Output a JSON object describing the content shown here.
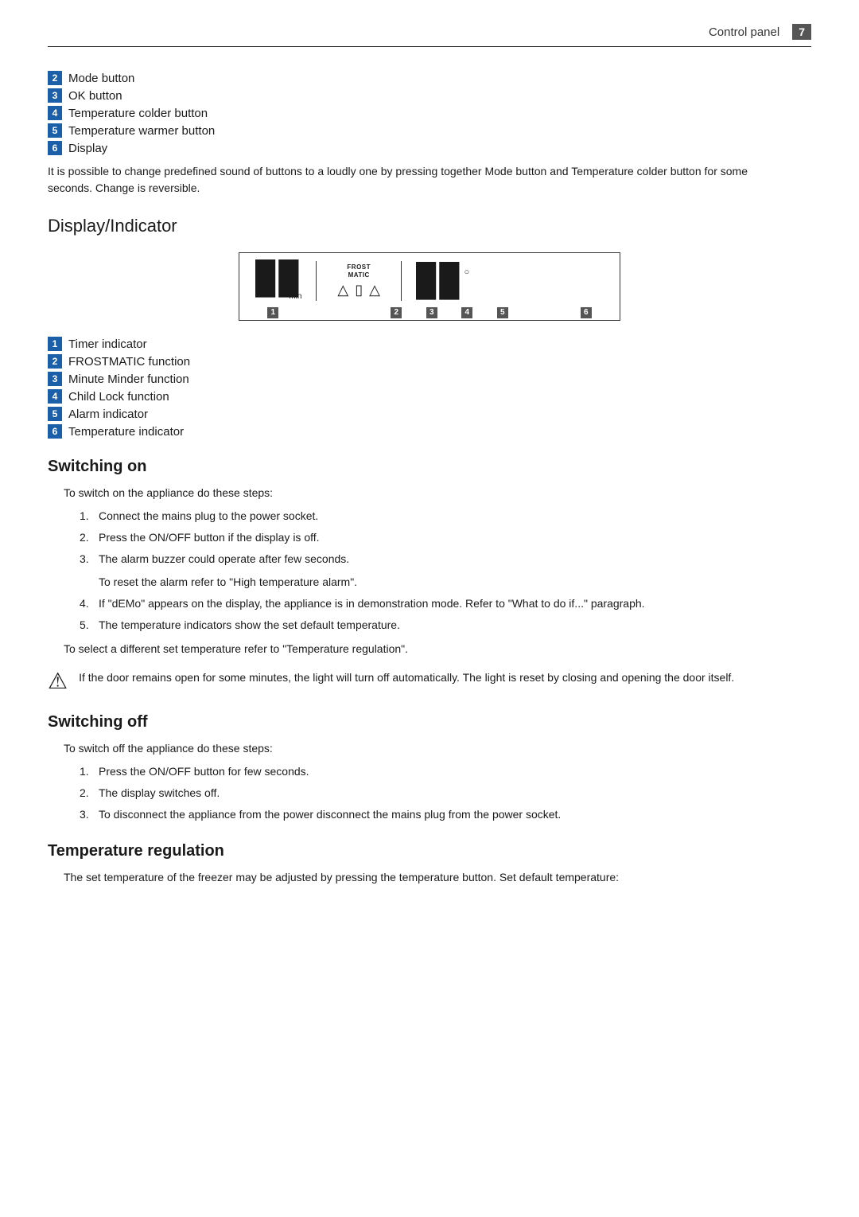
{
  "header": {
    "title": "Control panel",
    "page": "7"
  },
  "intro_list": {
    "items": [
      {
        "badge": "2",
        "label": "Mode button"
      },
      {
        "badge": "3",
        "label": "OK button"
      },
      {
        "badge": "4",
        "label": "Temperature colder button"
      },
      {
        "badge": "5",
        "label": "Temperature warmer button"
      },
      {
        "badge": "6",
        "label": "Display"
      }
    ]
  },
  "intro_note": "It is possible to change predefined sound of buttons to a loudly one by pressing together Mode button and Temperature colder button for some seconds. Change is reversible.",
  "display_section": {
    "title": "Display/Indicator",
    "diagram_labels": [
      "1",
      "2",
      "3",
      "4",
      "5",
      "6"
    ],
    "frost_matic": "FROST\nMATIC",
    "min_label": "min",
    "circle": "○",
    "indicators": [
      {
        "badge": "1",
        "label": "Timer indicator"
      },
      {
        "badge": "2",
        "label": "FROSTMATIC function"
      },
      {
        "badge": "3",
        "label": "Minute Minder function"
      },
      {
        "badge": "4",
        "label": "Child Lock function"
      },
      {
        "badge": "5",
        "label": "Alarm indicator"
      },
      {
        "badge": "6",
        "label": "Temperature indicator"
      }
    ]
  },
  "switching_on": {
    "title": "Switching on",
    "intro": "To switch on the appliance do these steps:",
    "steps": [
      "Connect the mains plug to the power socket.",
      "Press the ON/OFF button if the display is off.",
      "The alarm buzzer could operate after few seconds.",
      "If \"dEMo\" appears on the display, the appliance is in demonstration mode. Refer to \"What to do if...\" paragraph.",
      "The temperature indicators show the set default temperature."
    ],
    "step3_note": "To reset the alarm refer to \"High temperature alarm\".",
    "step5_note": "To select a different set temperature refer to \"Temperature regulation\".",
    "warning": "If the door remains open for some minutes, the light will turn off automatically. The light is reset by closing and opening the door itself."
  },
  "switching_off": {
    "title": "Switching off",
    "intro": "To switch off the appliance do these steps:",
    "steps": [
      "Press the ON/OFF button for few seconds.",
      "The display switches off.",
      "To disconnect the appliance from the power disconnect the mains plug from the power socket."
    ]
  },
  "temperature_regulation": {
    "title": "Temperature regulation",
    "text": "The set temperature of the freezer may be adjusted by pressing the temperature button. Set default temperature:"
  }
}
